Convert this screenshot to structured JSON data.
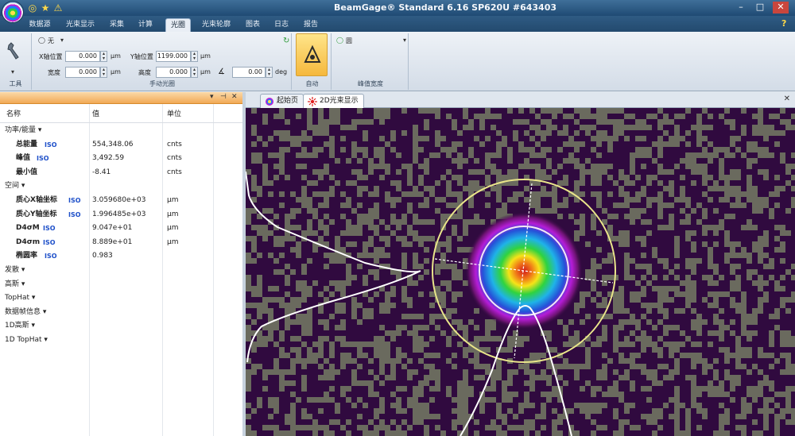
{
  "window": {
    "title": "BeamGage® Standard 6.16 SP620U #643403",
    "controls": [
      "–",
      "□",
      "✕"
    ],
    "quick_access": [
      "◎",
      "★",
      "⚠"
    ]
  },
  "tabs": [
    {
      "label": "数据源",
      "active": false
    },
    {
      "label": "光束显示",
      "active": false
    },
    {
      "label": "采集",
      "active": false
    },
    {
      "label": "计算",
      "active": false
    },
    {
      "label": "光圈",
      "active": true
    },
    {
      "label": "光束轮廓",
      "active": false
    },
    {
      "label": "图表",
      "active": false
    },
    {
      "label": "日志",
      "active": false
    },
    {
      "label": "报告",
      "active": false
    }
  ],
  "help_label": "?",
  "ribbon": {
    "tools_group_label": "工具",
    "aperture_type": "无",
    "x_pos_label": "X轴位置",
    "x_pos_value": "0.000",
    "y_pos_label": "Y轴位置",
    "y_pos_value": "1199.000",
    "width_label": "宽度",
    "width_value": "0.000",
    "height_label": "高度",
    "height_value": "0.000",
    "angle_value": "0.00",
    "unit_um": "µm",
    "unit_deg": "deg",
    "manual_group_label": "手动光圈",
    "auto_group_label": "自动",
    "peak_mode": "圆",
    "peak_group_label": "峰值宽度"
  },
  "left_panel": {
    "col_name": "名称",
    "col_value": "值",
    "col_unit": "单位",
    "header_buttons": [
      "▾",
      "⊣",
      "✕"
    ],
    "rows": [
      {
        "type": "cat",
        "label": "功率/能量 ▾"
      },
      {
        "type": "item",
        "label": "总能量",
        "iso": "ISO",
        "value": "554,348.06",
        "unit": "cnts"
      },
      {
        "type": "item",
        "label": "峰值",
        "iso": "ISO",
        "value": "3,492.59",
        "unit": "cnts"
      },
      {
        "type": "item",
        "label": "最小值",
        "iso": "",
        "value": "-8.41",
        "unit": "cnts"
      },
      {
        "type": "cat",
        "label": "空间 ▾"
      },
      {
        "type": "item",
        "label": "质心X轴坐标",
        "iso": "ISO",
        "value": "3.059680e+03",
        "unit": "µm"
      },
      {
        "type": "item",
        "label": "质心Y轴坐标",
        "iso": "ISO",
        "value": "1.996485e+03",
        "unit": "µm"
      },
      {
        "type": "item",
        "label": "D4σM",
        "iso": "ISO",
        "value": "9.047e+01",
        "unit": "µm"
      },
      {
        "type": "item",
        "label": "D4σm",
        "iso": "ISO",
        "value": "8.889e+01",
        "unit": "µm"
      },
      {
        "type": "item",
        "label": "椭圆率",
        "iso": "ISO",
        "value": "0.983",
        "unit": ""
      },
      {
        "type": "cat",
        "label": "发散 ▾"
      },
      {
        "type": "cat",
        "label": "高斯 ▾"
      },
      {
        "type": "cat",
        "label": "TopHat ▾"
      },
      {
        "type": "cat",
        "label": "数据帧信息 ▾"
      },
      {
        "type": "cat",
        "label": "1D高斯 ▾"
      },
      {
        "type": "cat",
        "label": "1D TopHat ▾"
      }
    ]
  },
  "doc_tabs": [
    {
      "label": "起始页",
      "active": false
    },
    {
      "label": "2D光束显示",
      "active": true
    }
  ],
  "doc_close": "✕",
  "colors": {
    "noise_bg": "#300a3f",
    "noise_fg": "#6a6a5e",
    "aperture_ring": "#e9e58a",
    "profile_line": "#ffffff"
  }
}
